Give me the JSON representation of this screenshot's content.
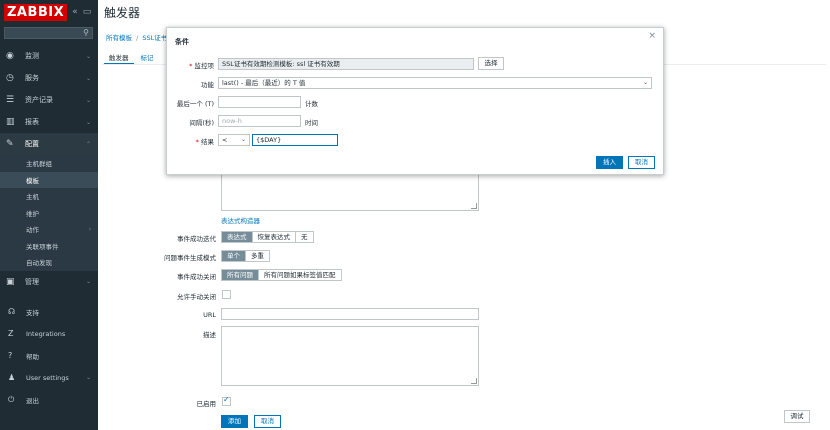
{
  "logo": "ZABBIX",
  "sidebar": {
    "collapse_glyph": "«",
    "kiosk_glyph": "▭",
    "search_icon": "search-icon",
    "items": [
      {
        "label": "监测",
        "icon": "eye-icon",
        "glyph": "◉"
      },
      {
        "label": "服务",
        "icon": "clock-icon",
        "glyph": "◷"
      },
      {
        "label": "资产记录",
        "icon": "list-icon",
        "glyph": "☰"
      },
      {
        "label": "报表",
        "icon": "chart-icon",
        "glyph": "▥"
      },
      {
        "label": "配置",
        "icon": "wrench-icon",
        "glyph": "✎"
      }
    ],
    "sub_items": [
      "主机群组",
      "模板",
      "主机",
      "维护",
      "动作",
      "关联项事件",
      "自动发现"
    ],
    "admin": {
      "label": "管理",
      "icon": "admin-icon",
      "glyph": "▣"
    },
    "bottom": [
      {
        "label": "支持",
        "icon": "headset-icon",
        "glyph": "☊"
      },
      {
        "label": "Integrations",
        "icon": "integrations-icon",
        "glyph": "Z"
      },
      {
        "label": "帮助",
        "icon": "help-icon",
        "glyph": "?"
      },
      {
        "label": "User settings",
        "icon": "user-icon",
        "glyph": "♟"
      },
      {
        "label": "退出",
        "icon": "power-icon",
        "glyph": "⏻"
      }
    ]
  },
  "main": {
    "title": "触发器",
    "breadcrumb": [
      "所有模板",
      "SSL证书"
    ],
    "breadcrumb_sep": "/",
    "tabs": [
      "触发器",
      "标记"
    ],
    "expression_builder": "表达式构造器",
    "ok_event_gen": {
      "label": "事件成功迭代",
      "options": [
        "表达式",
        "恢复表达式",
        "无"
      ],
      "selected": 0
    },
    "problem_mode": {
      "label": "问题事件生成模式",
      "options": [
        "单个",
        "多重"
      ],
      "selected": 0
    },
    "ok_close": {
      "label": "事件成功关闭",
      "options": [
        "所有问题",
        "所有问题如果标签值匹配"
      ],
      "selected": 0
    },
    "manual_close_label": "允许手动关闭",
    "url_label": "URL",
    "desc_label": "描述",
    "enabled_label": "已启用",
    "add_button": "添加",
    "cancel_button": "取消",
    "test_button": "调试"
  },
  "modal": {
    "title": "条件",
    "close_glyph": "×",
    "required_mark": "*",
    "item_label": "监控项",
    "item_value": "SSL证书有效期检测模板: ssl 证书有效期",
    "select_button": "选择",
    "function_label": "功能",
    "function_value": "last() - 最后（最近）的 T 值",
    "last_t_label": "最后一个 (T)",
    "last_t_unit": "计数",
    "shift_label": "间隔(秒)",
    "shift_placeholder": "now-h",
    "shift_unit": "时间",
    "result_label": "结果",
    "result_op": "<",
    "result_value": "{$DAY}",
    "insert_button": "插入",
    "cancel_button": "取消"
  }
}
